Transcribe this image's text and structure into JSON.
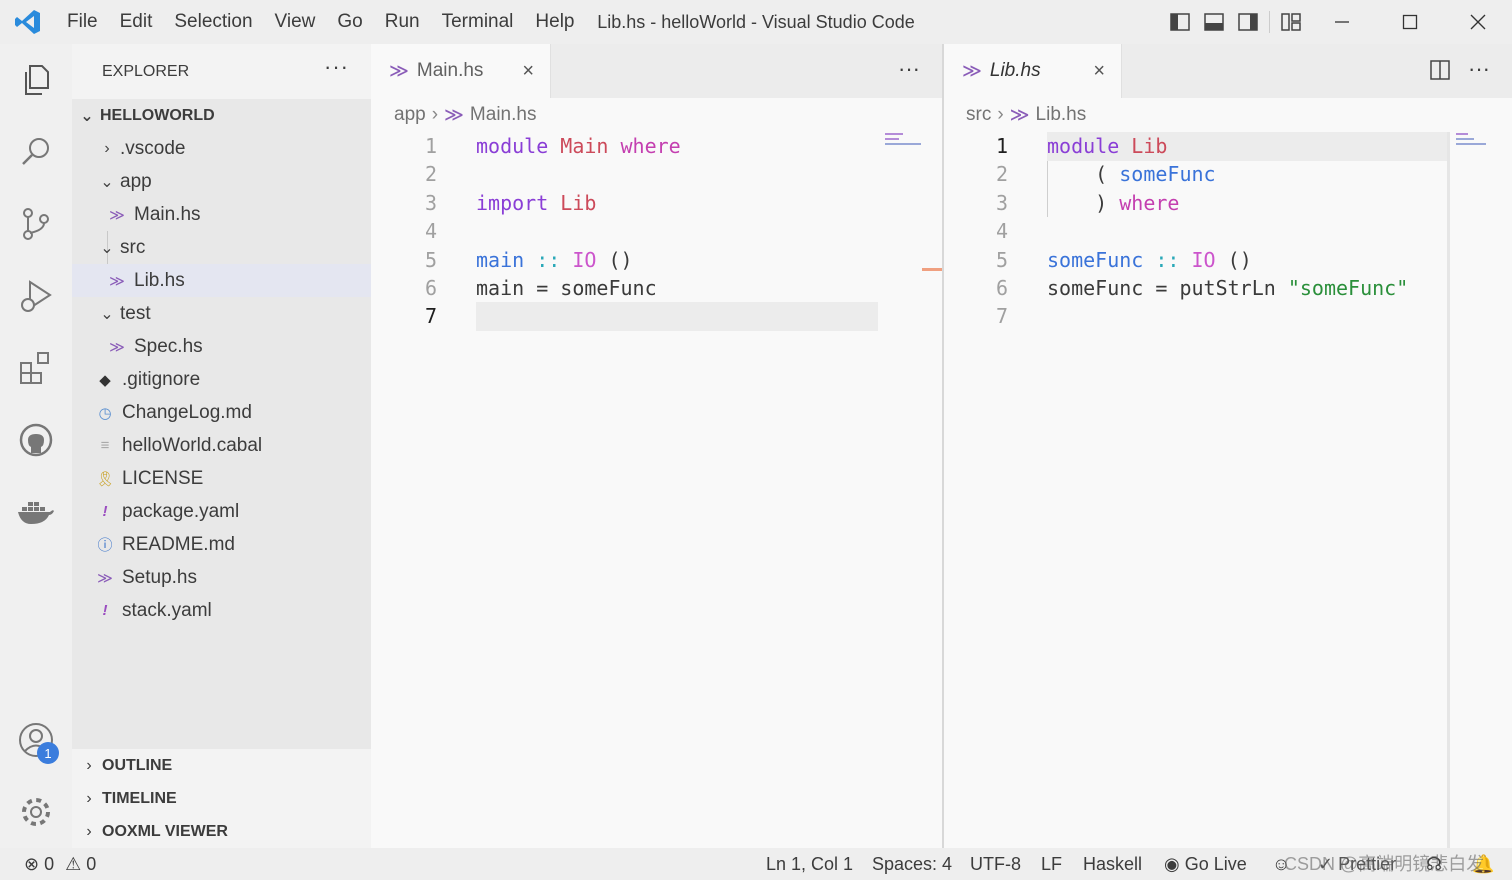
{
  "titlebar": {
    "menu": [
      "File",
      "Edit",
      "Selection",
      "View",
      "Go",
      "Run",
      "Terminal",
      "Help"
    ],
    "title": "Lib.hs - helloWorld - Visual Studio Code",
    "icons": [
      "toggle-primary-sidebar-icon",
      "toggle-panel-icon",
      "toggle-secondary-sidebar-icon",
      "customize-layout-icon",
      "minimize-icon",
      "maximize-icon",
      "close-icon"
    ]
  },
  "activity": {
    "items": [
      "explorer-icon",
      "search-icon",
      "source-control-icon",
      "run-debug-icon",
      "extensions-icon",
      "github-icon",
      "docker-icon",
      "accounts-icon",
      "settings-gear-icon"
    ],
    "accounts_badge": "1"
  },
  "sidebar": {
    "title": "EXPLORER",
    "more": "···",
    "root": "HELLOWORLD",
    "tree": [
      {
        "label": ".vscode",
        "kind": "folder",
        "expanded": false
      },
      {
        "label": "app",
        "kind": "folder",
        "expanded": true
      },
      {
        "label": "Main.hs",
        "kind": "haskell"
      },
      {
        "label": "src",
        "kind": "folder",
        "expanded": true
      },
      {
        "label": "Lib.hs",
        "kind": "haskell",
        "selected": true
      },
      {
        "label": "test",
        "kind": "folder",
        "expanded": true
      },
      {
        "label": "Spec.hs",
        "kind": "haskell"
      },
      {
        "label": ".gitignore",
        "kind": "git"
      },
      {
        "label": "ChangeLog.md",
        "kind": "changelog"
      },
      {
        "label": "helloWorld.cabal",
        "kind": "cabal"
      },
      {
        "label": "LICENSE",
        "kind": "license"
      },
      {
        "label": "package.yaml",
        "kind": "yaml"
      },
      {
        "label": "README.md",
        "kind": "readme"
      },
      {
        "label": "Setup.hs",
        "kind": "haskell"
      },
      {
        "label": "stack.yaml",
        "kind": "yaml"
      }
    ],
    "sections": [
      "OUTLINE",
      "TIMELINE",
      "OOXML VIEWER"
    ]
  },
  "editor_left": {
    "tab": "Main.hs",
    "more": "···",
    "breadcrumb": [
      "app",
      "Main.hs"
    ],
    "line_numbers": [
      "1",
      "2",
      "3",
      "4",
      "5",
      "6",
      "7"
    ],
    "active_line": "7",
    "colors": {
      "keyword": "#8a3ed6",
      "module": "#cc4a5a",
      "function": "#3a73d9",
      "type": "#cc55cc",
      "string": "#2a8f3a"
    }
  },
  "editor_right": {
    "tab": "Lib.hs",
    "breadcrumb": [
      "src",
      "Lib.hs"
    ],
    "line_numbers": [
      "1",
      "2",
      "3",
      "4",
      "5",
      "6",
      "7"
    ],
    "active_line": "1"
  },
  "status": {
    "errors": "0",
    "warnings": "0",
    "position": "Ln 1, Col 1",
    "spaces": "Spaces: 4",
    "encoding": "UTF-8",
    "eol": "LF",
    "language": "Haskell",
    "golive": "Go Live",
    "prettier": "Prettier",
    "watermark": "CSDN @高端明镜悲白发"
  }
}
